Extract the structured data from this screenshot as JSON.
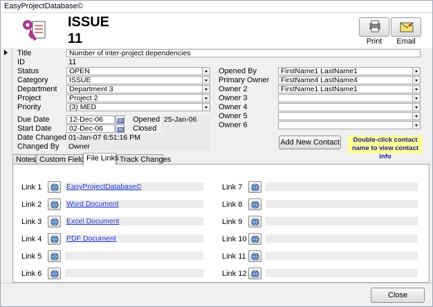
{
  "window": {
    "title": "EasyProjectDatabase©"
  },
  "header": {
    "record_type": "ISSUE",
    "record_id": "11"
  },
  "toolbar": {
    "print_label": "Print",
    "email_label": "Email"
  },
  "fields": {
    "title": {
      "label": "Title",
      "value": "Number of inter-project dependencies"
    },
    "id": {
      "label": "ID",
      "value": "11"
    },
    "status": {
      "label": "Status",
      "value": "OPEN"
    },
    "category": {
      "label": "Category",
      "value": "ISSUE"
    },
    "department": {
      "label": "Department",
      "value": "Department 3"
    },
    "project": {
      "label": "Project",
      "value": "Project 2"
    },
    "priority": {
      "label": "Priority",
      "value": "(3) MED"
    },
    "due_date": {
      "label": "Due Date",
      "value": "12-Dec-06"
    },
    "start_date": {
      "label": "Start Date",
      "value": "02-Dec-06"
    },
    "opened": {
      "label": "Opened",
      "value": "25-Jan-06"
    },
    "closed": {
      "label": "Closed",
      "value": ""
    },
    "date_changed": {
      "label": "Date Changed",
      "value": "01-Jan-07 6:51:16 PM"
    },
    "changed_by": {
      "label": "Changed By",
      "value": "Owner"
    },
    "opened_by": {
      "label": "Opened By",
      "value": "FirstName1 LastName1"
    },
    "primary_owner": {
      "label": "Primary Owner",
      "value": "FirstName4 LastName4"
    },
    "owner2": {
      "label": "Owner 2",
      "value": "FirstName1 LastName1"
    },
    "owner3": {
      "label": "Owner 3",
      "value": ""
    },
    "owner4": {
      "label": "Owner 4",
      "value": ""
    },
    "owner5": {
      "label": "Owner 5",
      "value": ""
    },
    "owner6": {
      "label": "Owner 6",
      "value": ""
    }
  },
  "contact": {
    "add_button": "Add New Contact",
    "hint": "Double-click contact name to view contact info"
  },
  "tabs": [
    {
      "label": "Notes"
    },
    {
      "label": "Custom Fields"
    },
    {
      "label": "File Links"
    },
    {
      "label": "Track Changes"
    }
  ],
  "links": [
    {
      "label": "Link 1",
      "value": "EasyProjectDatabase©"
    },
    {
      "label": "Link 2",
      "value": "Word Document"
    },
    {
      "label": "Link 3",
      "value": "Excel Document"
    },
    {
      "label": "Link 4",
      "value": "PDF Document"
    },
    {
      "label": "Link 5",
      "value": ""
    },
    {
      "label": "Link 6",
      "value": ""
    },
    {
      "label": "Link 7",
      "value": ""
    },
    {
      "label": "Link 8",
      "value": ""
    },
    {
      "label": "Link 9",
      "value": ""
    },
    {
      "label": "Link 10",
      "value": ""
    },
    {
      "label": "Link 11",
      "value": ""
    },
    {
      "label": "Link 12",
      "value": ""
    }
  ],
  "footer": {
    "close_label": "Close"
  }
}
